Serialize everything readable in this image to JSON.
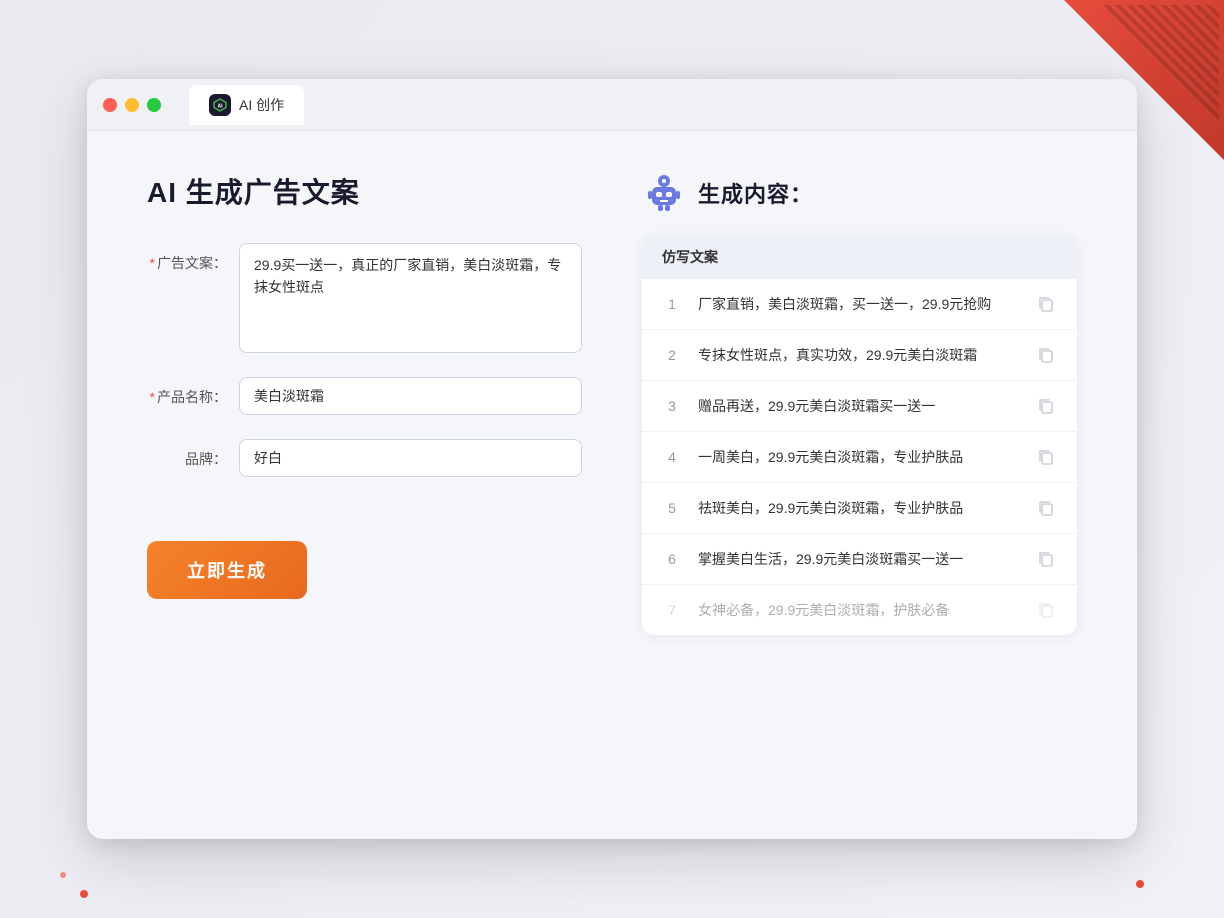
{
  "colors": {
    "accent_orange": "#f5832a",
    "accent_red": "#e74c3c",
    "brand_dark": "#1a1a2e",
    "brand_purple": "#6c7ae0",
    "border": "#d0d4e0",
    "bg": "#f5f6fa"
  },
  "browser": {
    "tab_label": "AI 创作",
    "tab_icon": "AI"
  },
  "left_panel": {
    "title": "AI 生成广告文案",
    "form": {
      "ad_copy_label": "广告文案：",
      "ad_copy_required": "*",
      "ad_copy_value": "29.9买一送一，真正的厂家直销，美白淡斑霜，专抹女性斑点",
      "product_label": "产品名称：",
      "product_required": "*",
      "product_value": "美白淡斑霜",
      "brand_label": "品牌：",
      "brand_value": "好白"
    },
    "generate_button": "立即生成"
  },
  "right_panel": {
    "title": "生成内容：",
    "table_header": "仿写文案",
    "results": [
      {
        "num": "1",
        "text": "厂家直销，美白淡斑霜，买一送一，29.9元抢购",
        "faded": false
      },
      {
        "num": "2",
        "text": "专抹女性斑点，真实功效，29.9元美白淡斑霜",
        "faded": false
      },
      {
        "num": "3",
        "text": "赠品再送，29.9元美白淡斑霜买一送一",
        "faded": false
      },
      {
        "num": "4",
        "text": "一周美白，29.9元美白淡斑霜，专业护肤品",
        "faded": false
      },
      {
        "num": "5",
        "text": "祛斑美白，29.9元美白淡斑霜，专业护肤品",
        "faded": false
      },
      {
        "num": "6",
        "text": "掌握美白生活，29.9元美白淡斑霜买一送一",
        "faded": false
      },
      {
        "num": "7",
        "text": "女神必备，29.9元美白淡斑霜，护肤必备",
        "faded": true
      }
    ]
  }
}
